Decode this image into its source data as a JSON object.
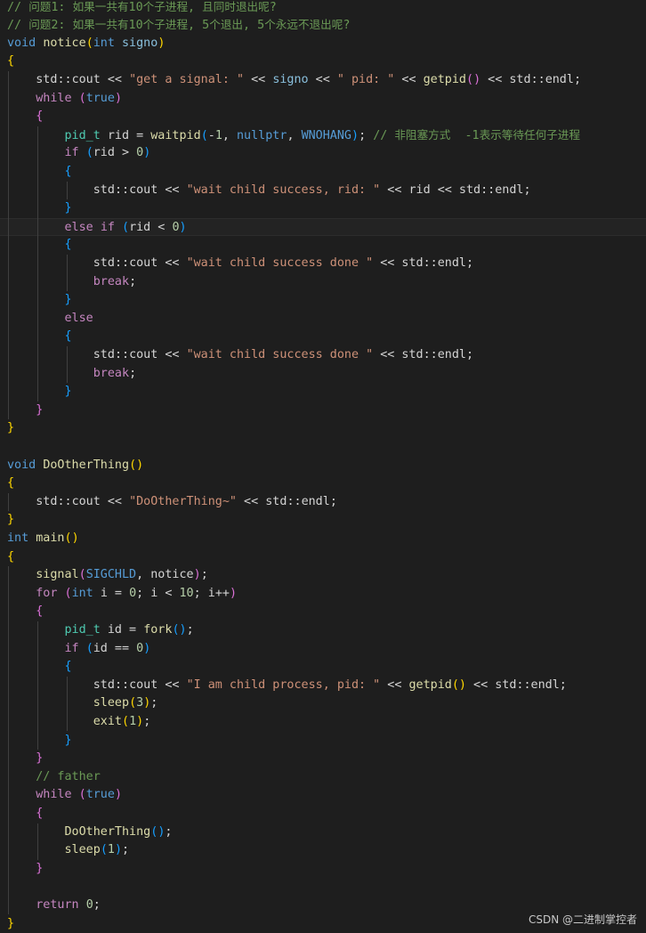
{
  "editor": {
    "language": "cpp",
    "colors": {
      "background": "#1e1e1e",
      "comment": "#6a9955",
      "keyword": "#569cd6",
      "control": "#c586c0",
      "function": "#dcdcaa",
      "type": "#4ec9b0",
      "string": "#ce9178",
      "number": "#b5cea8",
      "bracket_gold": "#ffd700",
      "bracket_purple": "#da70d6",
      "bracket_blue": "#179fff"
    },
    "lines": [
      "// 问题1: 如果一共有10个子进程, 且同时退出呢?",
      "// 问题2: 如果一共有10个子进程, 5个退出, 5个永远不退出呢?",
      "void notice(int signo)",
      "{",
      "    std::cout << \"get a signal: \" << signo << \" pid: \" << getpid() << std::endl;",
      "    while (true)",
      "    {",
      "        pid_t rid = waitpid(-1, nullptr, WNOHANG); // 非阻塞方式  -1表示等待任何子进程",
      "        if (rid > 0)",
      "        {",
      "            std::cout << \"wait child success, rid: \" << rid << std::endl;",
      "        }",
      "        else if (rid < 0)",
      "        {",
      "            std::cout << \"wait child success done \" << std::endl;",
      "            break;",
      "        }",
      "        else",
      "        {",
      "            std::cout << \"wait child success done \" << std::endl;",
      "            break;",
      "        }",
      "    }",
      "}",
      "",
      "void DoOtherThing()",
      "{",
      "    std::cout << \"DoOtherThing~\" << std::endl;",
      "}",
      "int main()",
      "{",
      "    signal(SIGCHLD, notice);",
      "    for (int i = 0; i < 10; i++)",
      "    {",
      "        pid_t id = fork();",
      "        if (id == 0)",
      "        {",
      "            std::cout << \"I am child process, pid: \" << getpid() << std::endl;",
      "            sleep(3);",
      "            exit(1);",
      "        }",
      "    }",
      "    // father",
      "    while (true)",
      "    {",
      "        DoOtherThing();",
      "        sleep(1);",
      "    }",
      "",
      "    return 0;",
      "}"
    ],
    "current_line": 13
  },
  "watermark": "CSDN @二进制掌控者"
}
